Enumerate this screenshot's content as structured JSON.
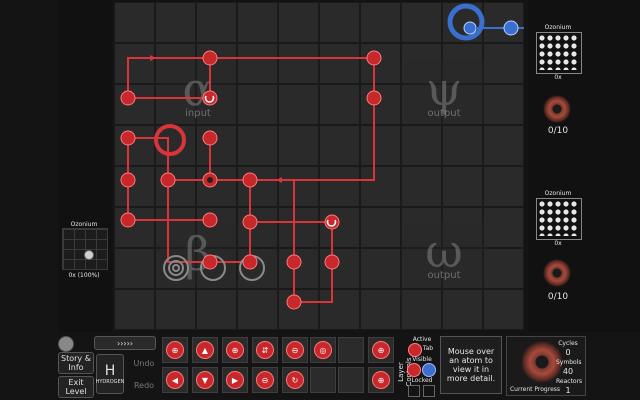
{
  "level": {
    "zones": {
      "input": {
        "symbol": "α",
        "label": "input"
      },
      "input_beta": {
        "symbol": "β",
        "label": ""
      },
      "output_psi": {
        "symbol": "ψ",
        "label": "output"
      },
      "output_omega": {
        "symbol": "ω",
        "label": "output"
      }
    }
  },
  "left_panel": {
    "mini_title": "Ozonium",
    "mini_footer": "0x (100%)"
  },
  "right_panel": {
    "output1": {
      "title": "Ozonium",
      "count": "0x",
      "progress": "0/10"
    },
    "output2": {
      "title": "Ozonium",
      "count": "0x",
      "progress": "0/10"
    }
  },
  "bottom": {
    "story_label": "Story & Info",
    "exit_label": "Exit Level",
    "hydrogen_symbol": "H",
    "hydrogen_name": "HYDROGEN",
    "undo_label": "Undo",
    "redo_label": "Redo",
    "layer_controls_label": "Layer Controls",
    "active_label": "Active",
    "tab_key": "Tab",
    "visible_label": "Visible",
    "locked_label": "Locked",
    "hint_text": "Mouse over an atom to view it in more detail.",
    "progress_label": "Current Progress",
    "stats": {
      "cycles_label": "Cycles",
      "cycles_value": "0",
      "symbols_label": "Symbols",
      "symbols_value": "40",
      "reactors_label": "Reactors",
      "reactors_value": "1"
    }
  },
  "colors": {
    "red": "#c8282c",
    "blue": "#3a6fd0",
    "bg": "#141414"
  }
}
